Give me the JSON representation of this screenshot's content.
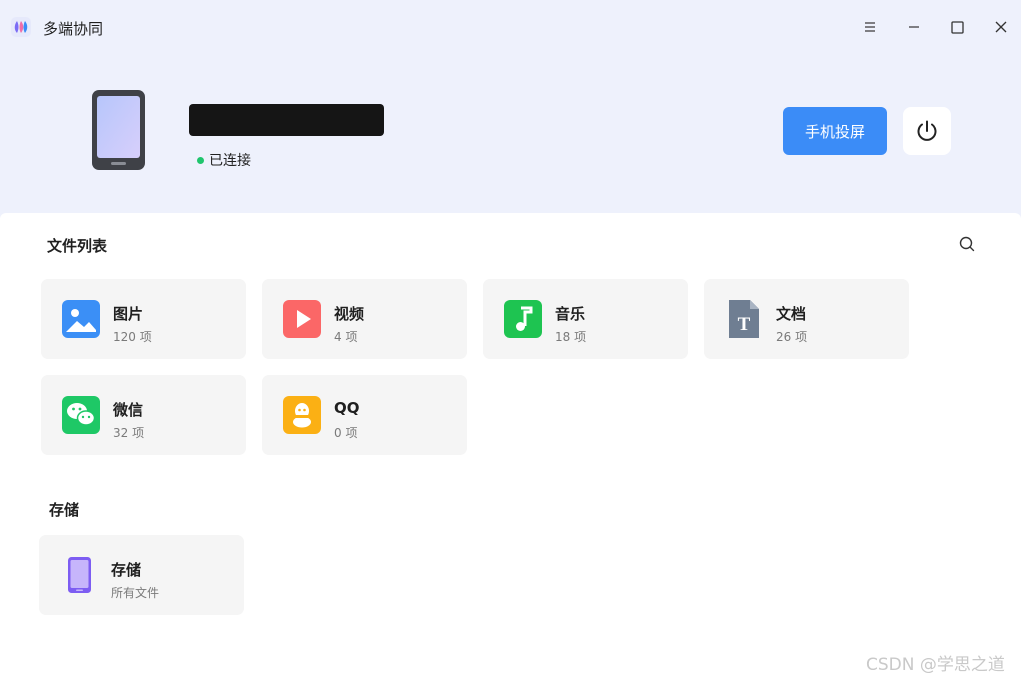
{
  "app": {
    "title": "多端协同"
  },
  "window_controls": [
    "menu-icon",
    "minimize-icon",
    "maximize-icon",
    "close-icon"
  ],
  "device": {
    "name": "",
    "status": "已连接",
    "status_color": "#1fc56d"
  },
  "actions": {
    "mirror_label": "手机投屏",
    "accent": "#3b8cf7"
  },
  "file_list": {
    "title": "文件列表",
    "items": [
      {
        "icon": "image-icon",
        "name": "图片",
        "count": "120 项"
      },
      {
        "icon": "video-icon",
        "name": "视频",
        "count": "4 项"
      },
      {
        "icon": "music-icon",
        "name": "音乐",
        "count": "18 项"
      },
      {
        "icon": "document-icon",
        "name": "文档",
        "count": "26 项"
      },
      {
        "icon": "wechat-icon",
        "name": "微信",
        "count": "32 项"
      },
      {
        "icon": "qq-icon",
        "name": "QQ",
        "count": "0 项"
      }
    ]
  },
  "storage": {
    "title": "存储",
    "items": [
      {
        "icon": "phone-storage-icon",
        "name": "存储",
        "count": "所有文件"
      }
    ]
  },
  "watermark": "CSDN @学思之道"
}
